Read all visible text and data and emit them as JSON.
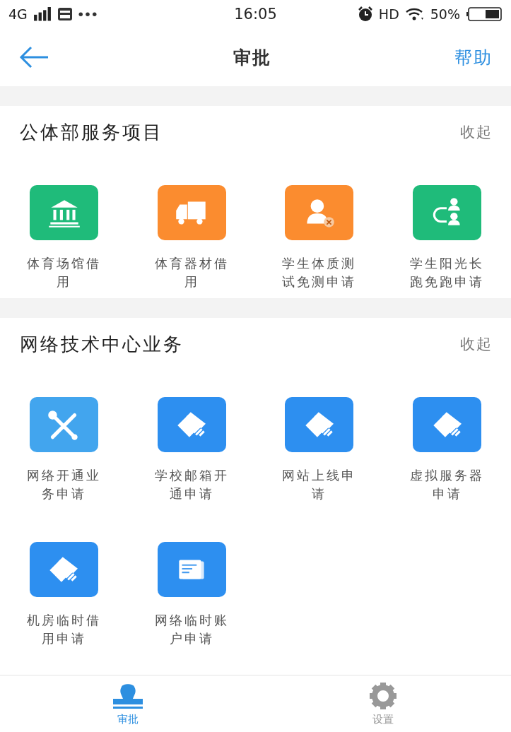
{
  "status_bar": {
    "network": "4G",
    "time": "16:05",
    "hd": "HD",
    "battery": "50%"
  },
  "nav": {
    "title": "审批",
    "action": "帮助"
  },
  "sections": [
    {
      "title": "公体部服务项目",
      "toggle": "收起",
      "items": [
        {
          "label": "体育场馆借用",
          "kind": "building",
          "color": "#1fbb7a"
        },
        {
          "label": "体育器材借用",
          "kind": "truck",
          "color": "#fb8c2f"
        },
        {
          "label": "学生体质测试免测申请",
          "kind": "person-x",
          "color": "#fb8c2f"
        },
        {
          "label": "学生阳光长跑免跑申请",
          "kind": "people",
          "color": "#1fbb7a"
        }
      ]
    },
    {
      "title": "网络技术中心业务",
      "toggle": "收起",
      "items": [
        {
          "label": "网络开通业务申请",
          "kind": "tools",
          "color": "#42a5ee"
        },
        {
          "label": "学校邮箱开通申请",
          "kind": "card",
          "color": "#2d8ff0"
        },
        {
          "label": "网站上线申请",
          "kind": "card",
          "color": "#2d8ff0"
        },
        {
          "label": "虚拟服务器申请",
          "kind": "card",
          "color": "#2d8ff0"
        },
        {
          "label": "机房临时借用申请",
          "kind": "card",
          "color": "#2d8ff0"
        },
        {
          "label": "网络临时账户申请",
          "kind": "document",
          "color": "#2d8ff0"
        }
      ]
    }
  ],
  "tabs": [
    {
      "label": "审批",
      "kind": "stamp",
      "selected": true
    },
    {
      "label": "设置",
      "kind": "gear",
      "selected": false
    }
  ]
}
